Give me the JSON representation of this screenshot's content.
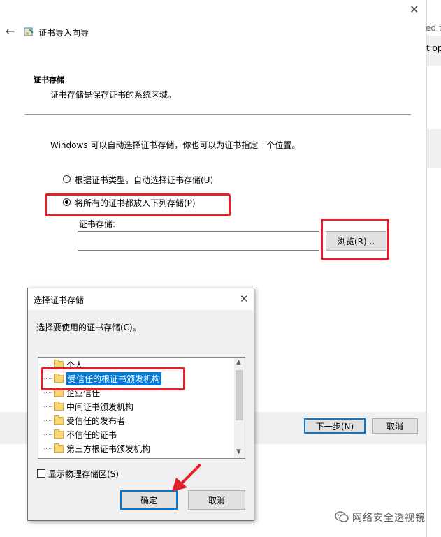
{
  "background_window": {
    "fragment_1": "ed to",
    "fragment_2": "t op"
  },
  "wizard": {
    "title": "证书导入向导",
    "section_title": "证书存储",
    "section_desc": "证书存储是保存证书的系统区域。",
    "intro": "Windows 可以自动选择证书存储，你也可以为证书指定一个位置。",
    "radio_auto_label": "根据证书类型，自动选择证书存储(U)",
    "radio_manual_label": "将所有的证书都放入下列存储(P)",
    "store_label": "证书存储:",
    "store_value": "",
    "browse_button": "浏览(R)...",
    "next_button": "下一步(N)",
    "cancel_button": "取消"
  },
  "dialog": {
    "title": "选择证书存储",
    "prompt": "选择要使用的证书存储(C)。",
    "tree_items": [
      "个人",
      "受信任的根证书颁发机构",
      "企业信任",
      "中间证书颁发机构",
      "受信任的发布者",
      "不信任的证书",
      "第三方根证书颁发机构"
    ],
    "selected_index": 1,
    "show_physical_label": "显示物理存储区(S)",
    "ok_button": "确定",
    "cancel_button": "取消"
  },
  "annotations": {
    "highlight_color": "#e2202a",
    "selection_color": "#0078d7"
  },
  "watermark": {
    "text": "网络安全透视镜"
  }
}
